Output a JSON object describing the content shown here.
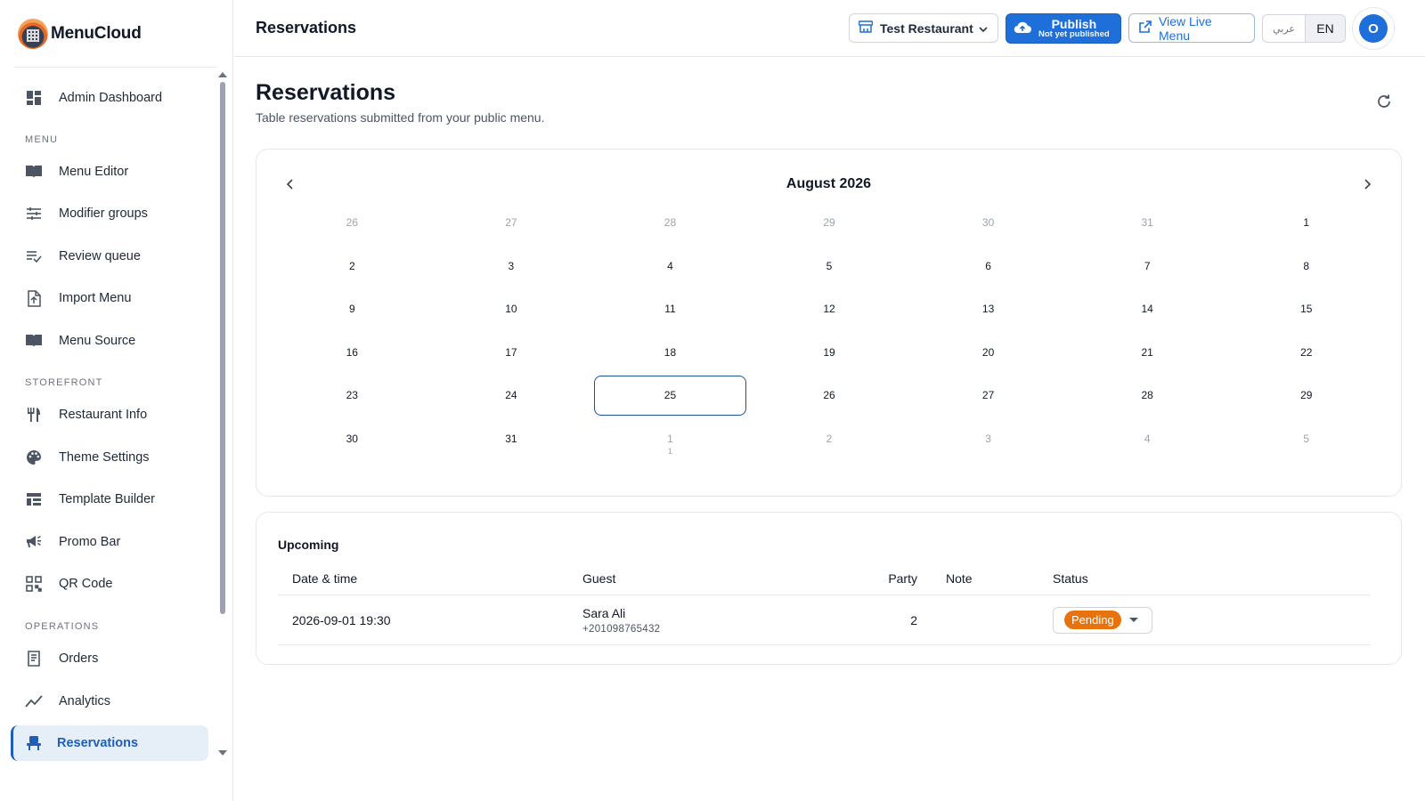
{
  "app": {
    "name": "MenuCloud"
  },
  "sidebar": {
    "items": [
      {
        "label": "Admin Dashboard",
        "icon": "dashboard-icon"
      },
      {
        "label": "Menu Editor",
        "icon": "book-icon"
      },
      {
        "label": "Modifier groups",
        "icon": "tune-icon"
      },
      {
        "label": "Review queue",
        "icon": "playlist-check-icon"
      },
      {
        "label": "Import Menu",
        "icon": "file-upload-icon"
      },
      {
        "label": "Menu Source",
        "icon": "book-icon"
      },
      {
        "label": "Restaurant Info",
        "icon": "utensils-icon"
      },
      {
        "label": "Theme Settings",
        "icon": "palette-icon"
      },
      {
        "label": "Template Builder",
        "icon": "layout-icon"
      },
      {
        "label": "Promo Bar",
        "icon": "megaphone-icon"
      },
      {
        "label": "QR Code",
        "icon": "qr-code-icon"
      },
      {
        "label": "Orders",
        "icon": "receipt-icon"
      },
      {
        "label": "Analytics",
        "icon": "chart-line-icon"
      },
      {
        "label": "Reservations",
        "icon": "chair-icon",
        "active": true
      }
    ],
    "sections": {
      "menu": "MENU",
      "storefront": "STOREFRONT",
      "operations": "OPERATIONS"
    }
  },
  "header": {
    "title": "Reservations",
    "restaurant": "Test Restaurant",
    "publish_label": "Publish",
    "publish_status": "Not yet published",
    "view_live": "View Live Menu",
    "lang_ar": "عربي",
    "lang_en": "EN",
    "avatar_initial": "O"
  },
  "page": {
    "title": "Reservations",
    "subtitle": "Table reservations submitted from your public menu."
  },
  "calendar": {
    "month": "August 2026",
    "weeks": [
      [
        {
          "d": "26",
          "m": true
        },
        {
          "d": "27",
          "m": true
        },
        {
          "d": "28",
          "m": true
        },
        {
          "d": "29",
          "m": true
        },
        {
          "d": "30",
          "m": true
        },
        {
          "d": "31",
          "m": true
        },
        {
          "d": "1"
        }
      ],
      [
        {
          "d": "2"
        },
        {
          "d": "3"
        },
        {
          "d": "4"
        },
        {
          "d": "5"
        },
        {
          "d": "6"
        },
        {
          "d": "7"
        },
        {
          "d": "8"
        }
      ],
      [
        {
          "d": "9"
        },
        {
          "d": "10"
        },
        {
          "d": "11"
        },
        {
          "d": "12"
        },
        {
          "d": "13"
        },
        {
          "d": "14"
        },
        {
          "d": "15"
        }
      ],
      [
        {
          "d": "16"
        },
        {
          "d": "17"
        },
        {
          "d": "18"
        },
        {
          "d": "19"
        },
        {
          "d": "20"
        },
        {
          "d": "21"
        },
        {
          "d": "22"
        }
      ],
      [
        {
          "d": "23"
        },
        {
          "d": "24"
        },
        {
          "d": "25",
          "selected": true
        },
        {
          "d": "26"
        },
        {
          "d": "27"
        },
        {
          "d": "28"
        },
        {
          "d": "29"
        }
      ],
      [
        {
          "d": "30"
        },
        {
          "d": "31"
        },
        {
          "d": "1",
          "m": true,
          "count": "1"
        },
        {
          "d": "2",
          "m": true
        },
        {
          "d": "3",
          "m": true
        },
        {
          "d": "4",
          "m": true
        },
        {
          "d": "5",
          "m": true
        }
      ]
    ]
  },
  "upcoming": {
    "title": "Upcoming",
    "columns": {
      "datetime": "Date & time",
      "guest": "Guest",
      "party": "Party",
      "note": "Note",
      "status": "Status"
    },
    "rows": [
      {
        "datetime": "2026-09-01 19:30",
        "guest_name": "Sara Ali",
        "guest_phone": "+201098765432",
        "party": "2",
        "note": "",
        "status": "Pending"
      }
    ]
  },
  "colors": {
    "accent": "#1e6fd9",
    "active_nav": "#1f5fb8",
    "pending": "#e8730c"
  }
}
